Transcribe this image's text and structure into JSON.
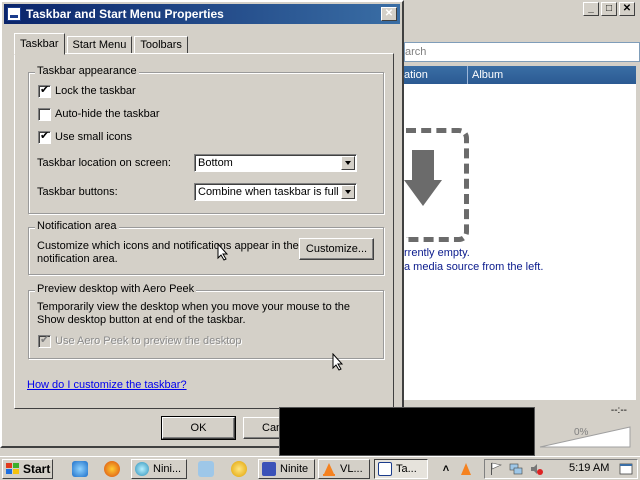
{
  "background_window": {
    "search_placeholder": "arch",
    "columns": [
      "ation",
      "Album"
    ],
    "empty_line1": "rrently empty.",
    "empty_line2": "a media source from the left.",
    "time_display": "--:--",
    "volume_percent": "0%"
  },
  "dialog": {
    "title": "Taskbar and Start Menu Properties",
    "tabs": [
      "Taskbar",
      "Start Menu",
      "Toolbars"
    ],
    "active_tab": "Taskbar",
    "appearance": {
      "legend": "Taskbar appearance",
      "lock_label": "Lock the taskbar",
      "lock_checked": true,
      "autohide_label": "Auto-hide the taskbar",
      "autohide_checked": false,
      "small_icons_label": "Use small icons",
      "small_icons_checked": true,
      "location_label": "Taskbar location on screen:",
      "location_value": "Bottom",
      "buttons_label": "Taskbar buttons:",
      "buttons_value": "Combine when taskbar is full"
    },
    "notification": {
      "legend": "Notification area",
      "desc_line1": "Customize which icons and notifications appear in the",
      "desc_line2": "notification area.",
      "customize_button": "Customize..."
    },
    "peek": {
      "legend": "Preview desktop with Aero Peek",
      "desc_line1": "Temporarily view the desktop when you move your mouse to the",
      "desc_line2": "Show desktop button at end of the taskbar.",
      "checkbox_label": "Use Aero Peek to preview the desktop",
      "checkbox_checked": true,
      "checkbox_disabled": true
    },
    "help_link": "How do I customize the taskbar?",
    "ok_button": "OK",
    "cancel_button": "Can"
  },
  "taskbar": {
    "start_label": "Start",
    "buttons": [
      {
        "label": "Nini...",
        "pressed": false
      },
      {
        "label": "Ninite",
        "pressed": false
      },
      {
        "label": "VL...",
        "pressed": false
      },
      {
        "label": "Ta...",
        "pressed": true
      }
    ],
    "clock": "5:19 AM"
  },
  "colors": {
    "title_bar_start": "#0a246a",
    "title_bar_end": "#3a6ea5",
    "face": "#d4d0c8",
    "link": "#0000ee"
  }
}
